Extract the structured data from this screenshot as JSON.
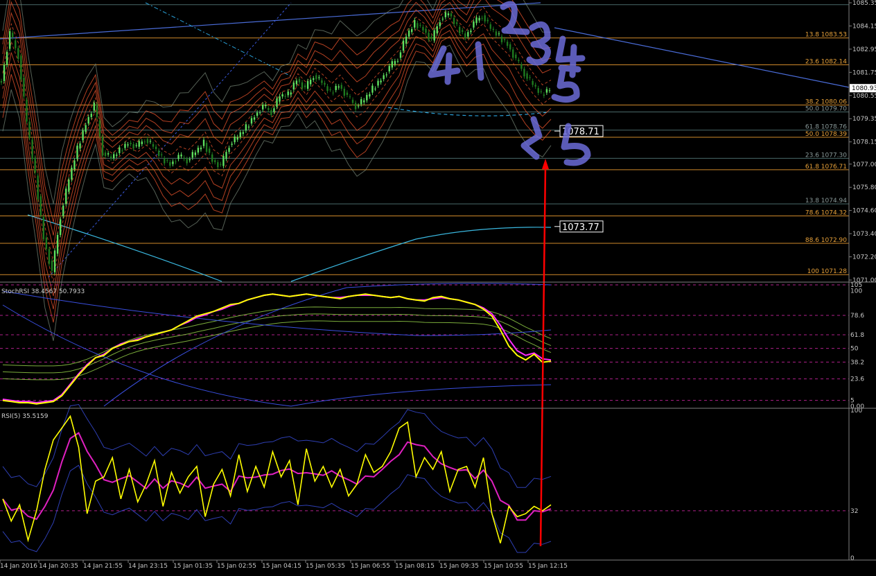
{
  "colors": {
    "background": "#000000",
    "grid": "#303030",
    "fib_line": "#d08a2a",
    "fib_label": "#e8a23a",
    "fib_label_dim": "#8a9a9a",
    "bull_candle": "#5fe05f",
    "bear_candle": "#1f7a1f",
    "envelope": "#e0502a",
    "trend_line": "#4a6cd8",
    "ma_long": "#3ab8e0",
    "stoch_main": "#ffff00",
    "stoch_signal": "#ff2aff",
    "rsi_main": "#ffff00",
    "rsi_signal": "#e020c0",
    "band_blue": "#3a4fe0",
    "level_dash": "#b0208a",
    "arrow": "#ff0000",
    "annotation_ink": "#6c6cd8"
  },
  "chart_data": [
    {
      "type": "candlestick",
      "panel": "price",
      "ylim": [
        1071.0,
        1085.35
      ],
      "y_ticks": [
        "1085.35",
        "1084.15",
        "1082.95",
        "1081.75",
        "1080.55",
        "1079.35",
        "1078.15",
        "1077.00",
        "1075.80",
        "1074.60",
        "1073.40",
        "1072.20",
        "1071.00"
      ],
      "current_price": "1080.93",
      "x_ticks": [
        "14 Jan 2016",
        "14 Jan 20:35",
        "14 Jan 21:55",
        "14 Jan 23:15",
        "15 Jan 01:35",
        "15 Jan 02:55",
        "15 Jan 04:15",
        "15 Jan 05:35",
        "15 Jan 06:55",
        "15 Jan 08:15",
        "15 Jan 09:35",
        "15 Jan 10:55",
        "15 Jan 12:15"
      ],
      "fib_levels": [
        {
          "label": "13.8 1083.53",
          "value": 1083.53,
          "style": "bright"
        },
        {
          "label": "23.6 1082.14",
          "value": 1082.14,
          "style": "bright"
        },
        {
          "label": "38.2 1080.06",
          "value": 1080.06,
          "style": "bright"
        },
        {
          "label": "50.0 1079.70",
          "value": 1079.7,
          "style": "dim"
        },
        {
          "label": "61.8 1078.76",
          "value": 1078.76,
          "style": "dim"
        },
        {
          "label": "50.0 1078.39",
          "value": 1078.39,
          "style": "bright"
        },
        {
          "label": "23.6 1077.30",
          "value": 1077.3,
          "style": "dim"
        },
        {
          "label": "61.8 1076.71",
          "value": 1076.71,
          "style": "bright"
        },
        {
          "label": "13.8 1074.94",
          "value": 1074.94,
          "style": "dim"
        },
        {
          "label": "78.6 1074.32",
          "value": 1074.32,
          "style": "bright"
        },
        {
          "label": "88.6 1072.90",
          "value": 1072.9,
          "style": "bright"
        },
        {
          "label": "100 1071.28",
          "value": 1071.28,
          "style": "bright"
        }
      ],
      "price_boxes": [
        {
          "label": "1078.71",
          "value": 1078.71
        },
        {
          "label": "1073.77",
          "value": 1073.77
        }
      ],
      "close_path": [
        1081.3,
        1083.8,
        1082.6,
        1079.2,
        1076.4,
        1073.2,
        1071.4,
        1074.3,
        1076.2,
        1077.8,
        1079.1,
        1080.1,
        1077.6,
        1077.3,
        1077.7,
        1078.1,
        1077.9,
        1078.3,
        1077.9,
        1077.3,
        1077.0,
        1077.4,
        1077.2,
        1077.6,
        1078.1,
        1077.2,
        1076.9,
        1078.0,
        1078.4,
        1078.9,
        1079.5,
        1080.0,
        1079.7,
        1080.5,
        1080.6,
        1081.4,
        1080.9,
        1081.6,
        1081.2,
        1080.7,
        1081.1,
        1080.5,
        1080.0,
        1080.3,
        1080.9,
        1081.4,
        1082.0,
        1082.5,
        1083.6,
        1084.3,
        1084.0,
        1083.4,
        1084.5,
        1084.8,
        1084.1,
        1083.6,
        1084.3,
        1084.7,
        1084.0,
        1083.6,
        1083.2,
        1082.4,
        1081.7,
        1081.1,
        1080.6,
        1080.9
      ]
    },
    {
      "type": "line",
      "panel": "stochrsi",
      "label": "StochRSI 38.4567 50.7933",
      "ylim": [
        0,
        105
      ],
      "y_ticks": [
        "105",
        "100",
        "78.6",
        "61.8",
        "50",
        "38.2",
        "23.6",
        "5",
        "0.00"
      ],
      "levels": [
        105,
        78.6,
        61.8,
        50,
        38.2,
        23.6,
        5
      ],
      "series": [
        {
          "name": "38.4567",
          "values": [
            5,
            4,
            3,
            3,
            2,
            3,
            4,
            9,
            18,
            27,
            35,
            42,
            44,
            50,
            53,
            56,
            57,
            60,
            62,
            64,
            66,
            70,
            74,
            78,
            80,
            82,
            85,
            88,
            89,
            92,
            94,
            96,
            97,
            96,
            95,
            96,
            97,
            96,
            95,
            94,
            93,
            95,
            96,
            97,
            96,
            95,
            94,
            95,
            93,
            92,
            91,
            94,
            95,
            93,
            92,
            90,
            88,
            84,
            78,
            66,
            52,
            44,
            40,
            45,
            38,
            39
          ]
        },
        {
          "name": "50.7933",
          "values": [
            6,
            5,
            4,
            4,
            3,
            4,
            5,
            10,
            19,
            28,
            36,
            42,
            45,
            50,
            54,
            56,
            58,
            60,
            62,
            64,
            66,
            70,
            73,
            77,
            79,
            82,
            84,
            87,
            89,
            92,
            94,
            96,
            97,
            96,
            95,
            96,
            97,
            96,
            95,
            94,
            94,
            95,
            96,
            96,
            96,
            95,
            94,
            95,
            93,
            92,
            92,
            93,
            94,
            93,
            92,
            90,
            88,
            85,
            80,
            70,
            58,
            48,
            44,
            46,
            41,
            40
          ]
        }
      ]
    },
    {
      "type": "line",
      "panel": "rsi",
      "label": "RSI(5) 35.5159",
      "ylim": [
        0,
        100
      ],
      "y_ticks": [
        "100",
        "32",
        "0"
      ],
      "levels": [
        32
      ],
      "series": [
        {
          "name": "35.5159",
          "values": [
            40,
            25,
            36,
            12,
            32,
            60,
            80,
            88,
            96,
            75,
            30,
            52,
            55,
            68,
            40,
            60,
            38,
            50,
            66,
            35,
            58,
            44,
            55,
            62,
            28,
            50,
            60,
            42,
            70,
            45,
            62,
            48,
            72,
            55,
            66,
            36,
            74,
            52,
            62,
            48,
            60,
            42,
            50,
            70,
            58,
            62,
            72,
            88,
            92,
            55,
            68,
            60,
            72,
            45,
            60,
            62,
            48,
            68,
            30,
            10,
            35,
            28,
            30,
            35,
            32,
            36
          ]
        }
      ]
    }
  ],
  "annotation_text": "4 1 2 3 4 5 5"
}
